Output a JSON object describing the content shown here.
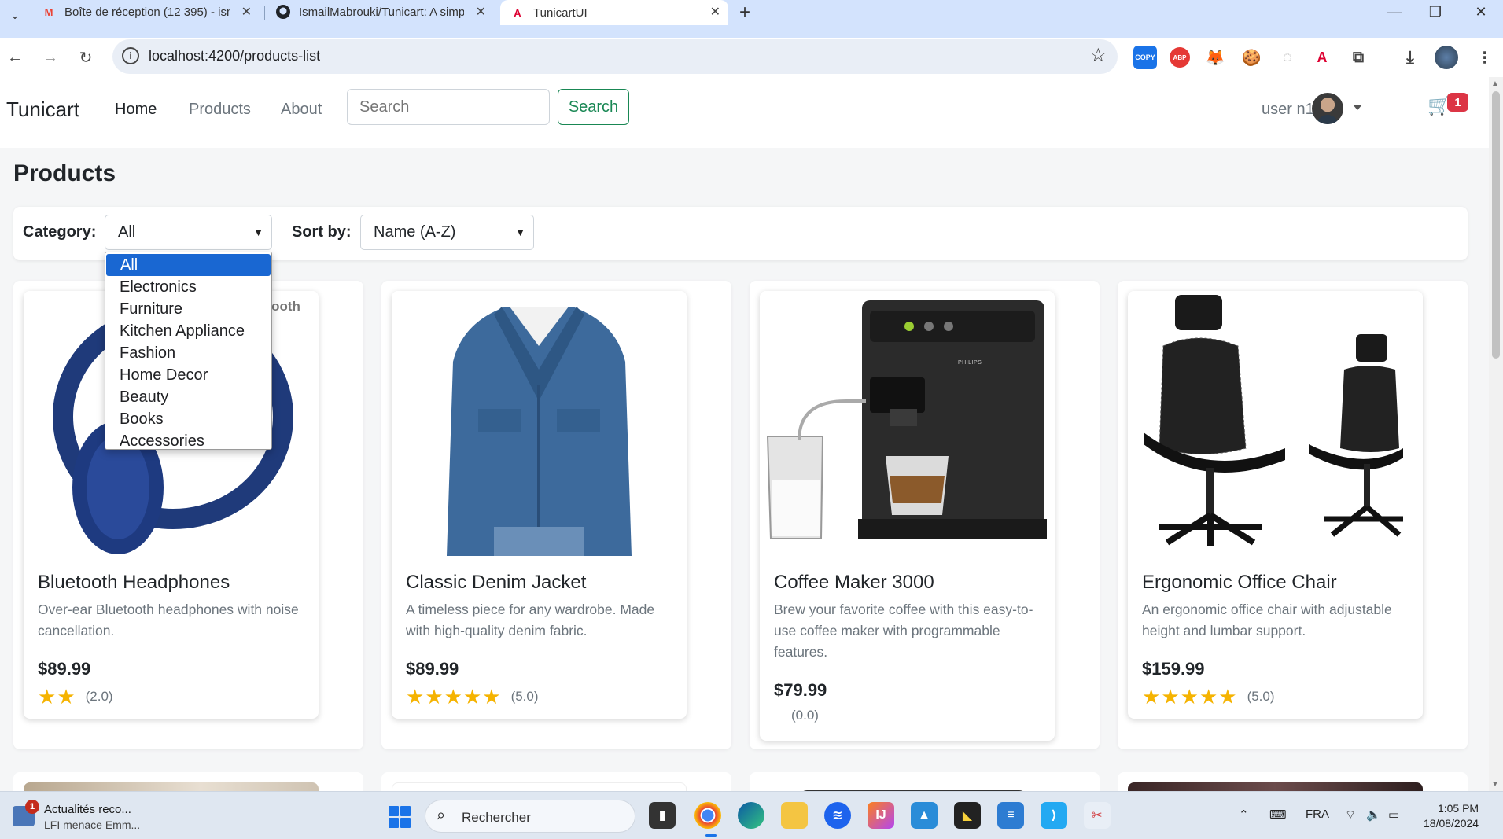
{
  "browser": {
    "tabs": [
      {
        "title": "Boîte de réception (12 395) - ism",
        "favicon": "gmail-icon"
      },
      {
        "title": "IsmailMabrouki/Tunicart: A simp",
        "favicon": "github-icon"
      },
      {
        "title": "TunicartUI",
        "favicon": "angular-icon"
      }
    ],
    "url": "localhost:4200/products-list",
    "extensions": [
      "COPY",
      "ABP"
    ]
  },
  "navbar": {
    "brand": "Tunicart",
    "links": [
      "Home",
      "Products",
      "About"
    ],
    "search_placeholder": "Search",
    "search_button": "Search",
    "user": "user n1",
    "cart_count": "1"
  },
  "page": {
    "title": "Products",
    "filters": {
      "category_label": "Category:",
      "category_value": "All",
      "sort_label": "Sort by:",
      "sort_value": "Name (A-Z)",
      "category_options": [
        "All",
        "Electronics",
        "Furniture",
        "Kitchen Appliance",
        "Fashion",
        "Home Decor",
        "Beauty",
        "Books",
        "Accessories"
      ],
      "selected_option_index": 0
    },
    "products": [
      {
        "name": "Bluetooth Headphones",
        "description": "Over-ear Bluetooth headphones with noise cancellation.",
        "price": "$89.99",
        "stars": 2,
        "rating_text": "(2.0)",
        "image_text": "etooth"
      },
      {
        "name": "Classic Denim Jacket",
        "description": "A timeless piece for any wardrobe. Made with high-quality denim fabric.",
        "price": "$89.99",
        "stars": 5,
        "rating_text": "(5.0)"
      },
      {
        "name": "Coffee Maker 3000",
        "description": "Brew your favorite coffee with this easy-to-use coffee maker with programmable features.",
        "price": "$79.99",
        "stars": 0,
        "rating_text": "(0.0)",
        "image_text": "PHILIPS"
      },
      {
        "name": "Ergonomic Office Chair",
        "description": "An ergonomic office chair with adjustable height and lumbar support.",
        "price": "$159.99",
        "stars": 5,
        "rating_text": "(5.0)"
      }
    ]
  },
  "taskbar": {
    "news_title": "Actualités reco...",
    "news_sub": "LFI menace Emm...",
    "news_badge": "1",
    "search_label": "Rechercher",
    "lang": "FRA",
    "time": "1:05 PM",
    "date": "18/08/2024"
  },
  "colors": {
    "accent_green": "#198754",
    "badge_red": "#dc3545",
    "star": "#f5b301",
    "dropdown_selected": "#1967d2"
  }
}
